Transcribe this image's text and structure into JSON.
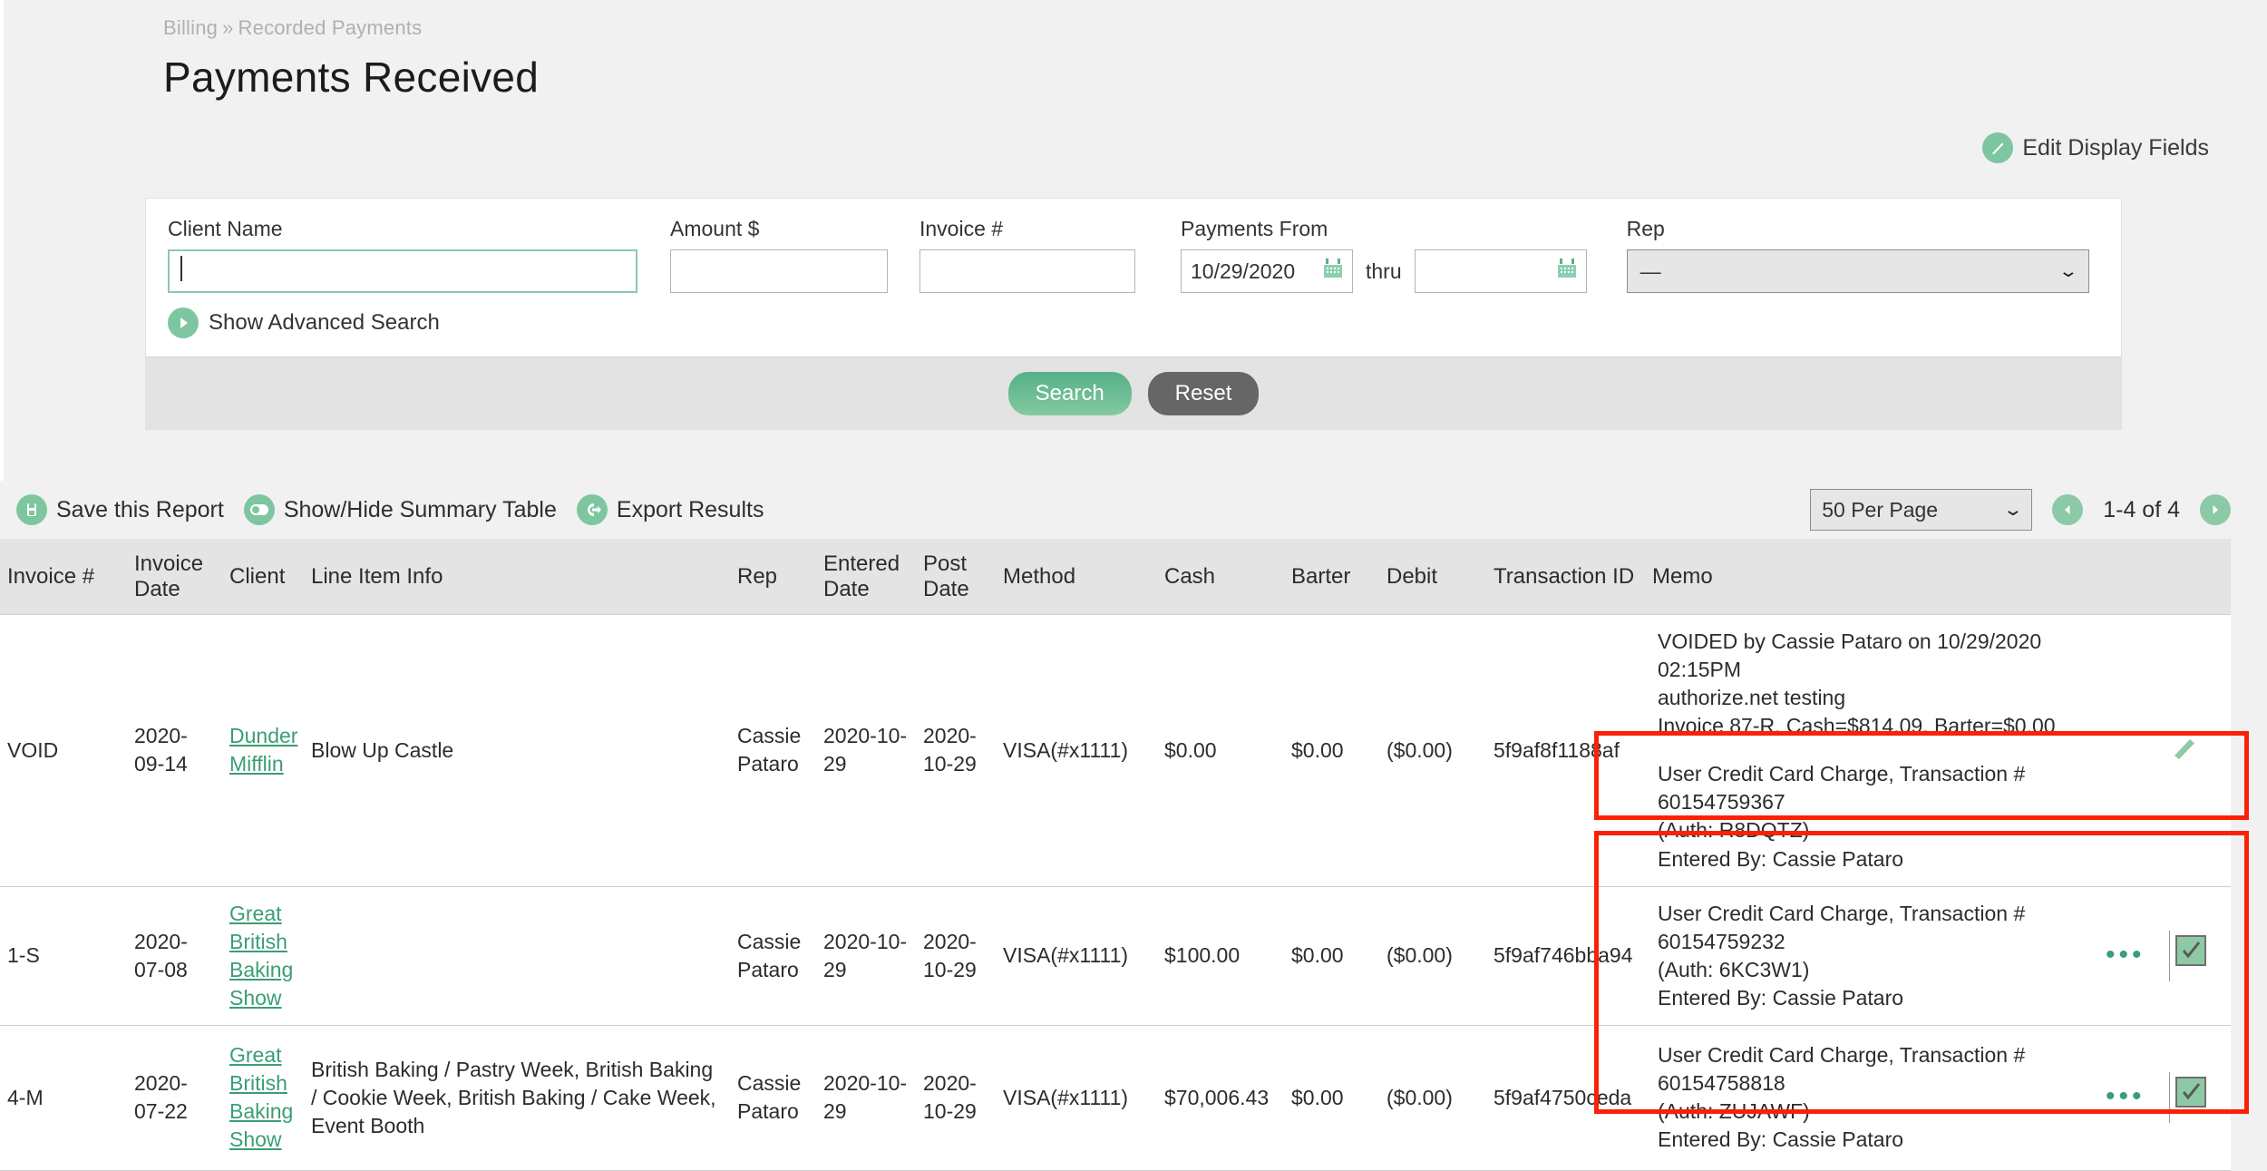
{
  "breadcrumb": {
    "parent": "Billing",
    "separator": "»",
    "current": "Recorded Payments"
  },
  "page_title": "Payments Received",
  "edit_display_fields": {
    "label": "Edit Display Fields",
    "icon": "pencil-circle-icon"
  },
  "search_form": {
    "client_name": {
      "label": "Client Name",
      "value": "",
      "placeholder": ""
    },
    "amount": {
      "label": "Amount $",
      "value": "",
      "placeholder": ""
    },
    "invoice_number": {
      "label": "Invoice #",
      "value": "",
      "placeholder": ""
    },
    "payments_from": {
      "label": "Payments From",
      "value": "10/29/2020",
      "thru_label": "thru",
      "thru_value": ""
    },
    "rep": {
      "label": "Rep",
      "value": "—",
      "options": [
        "—"
      ]
    },
    "advanced_search_label": "Show Advanced Search",
    "search_button": "Search",
    "reset_button": "Reset"
  },
  "report_toolbar": {
    "save_report": "Save this Report",
    "summary_table": "Show/Hide Summary Table",
    "export_results": "Export Results",
    "per_page": "50 Per Page",
    "per_page_options": [
      "50 Per Page"
    ],
    "range": "1-4 of 4"
  },
  "table": {
    "columns": [
      "Invoice #",
      "Invoice Date",
      "Client",
      "Line Item Info",
      "Rep",
      "Entered Date",
      "Post Date",
      "Method",
      "Cash",
      "Barter",
      "Debit",
      "Transaction ID",
      "Memo",
      "",
      ""
    ],
    "rows": [
      {
        "invoice": "VOID",
        "invoice_date": "2020-09-14",
        "client": "Dunder Mifflin",
        "line_item_info": "Blow Up Castle",
        "rep": "Cassie Pataro",
        "entered_date": "2020-10-29",
        "post_date": "2020-10-29",
        "method": "VISA(#x1111)",
        "cash": "$0.00",
        "barter": "$0.00",
        "debit": "($0.00)",
        "transaction_id": "5f9af8f1188af",
        "memo_top": "VOIDED by Cassie Pataro on 10/29/2020 02:15PM\nauthorize.net testing\nInvoice 87-R, Cash=$814.09, Barter=$0.00",
        "memo_boxed": "User Credit Card Charge, Transaction # 60154759367\n(Auth: R8DQTZ)\nEntered By: Cassie Pataro",
        "action": "edit-pencil-icon",
        "checkbox": false
      },
      {
        "invoice": "1-S",
        "invoice_date": "2020-07-08",
        "client": "Great British Baking Show",
        "line_item_info": "",
        "rep": "Cassie Pataro",
        "entered_date": "2020-10-29",
        "post_date": "2020-10-29",
        "method": "VISA(#x1111)",
        "cash": "$100.00",
        "barter": "$0.00",
        "debit": "($0.00)",
        "transaction_id": "5f9af746bba94",
        "memo_top": "",
        "memo_boxed": "User Credit Card Charge, Transaction # 60154759232\n(Auth: 6KC3W1)\nEntered By: Cassie Pataro",
        "action": "more-dots-icon",
        "checkbox": true
      },
      {
        "invoice": "4-M",
        "invoice_date": "2020-07-22",
        "client": "Great British Baking Show",
        "line_item_info": "British Baking / Pastry Week, British Baking / Cookie Week, British Baking / Cake Week, Event Booth",
        "rep": "Cassie Pataro",
        "entered_date": "2020-10-29",
        "post_date": "2020-10-29",
        "method": "VISA(#x1111)",
        "cash": "$70,006.43",
        "barter": "$0.00",
        "debit": "($0.00)",
        "transaction_id": "5f9af4750ceda",
        "memo_top": "",
        "memo_boxed": "User Credit Card Charge, Transaction # 60154758818\n(Auth: ZUJAWF)\nEntered By: Cassie Pataro",
        "action": "more-dots-icon",
        "checkbox": true
      }
    ]
  },
  "colors": {
    "accent_green": "#7dc6a0",
    "link_green": "#3a9e74",
    "annotation_red": "#fb2105",
    "page_bg": "#f1f1f1",
    "reset_gray": "#666666"
  }
}
